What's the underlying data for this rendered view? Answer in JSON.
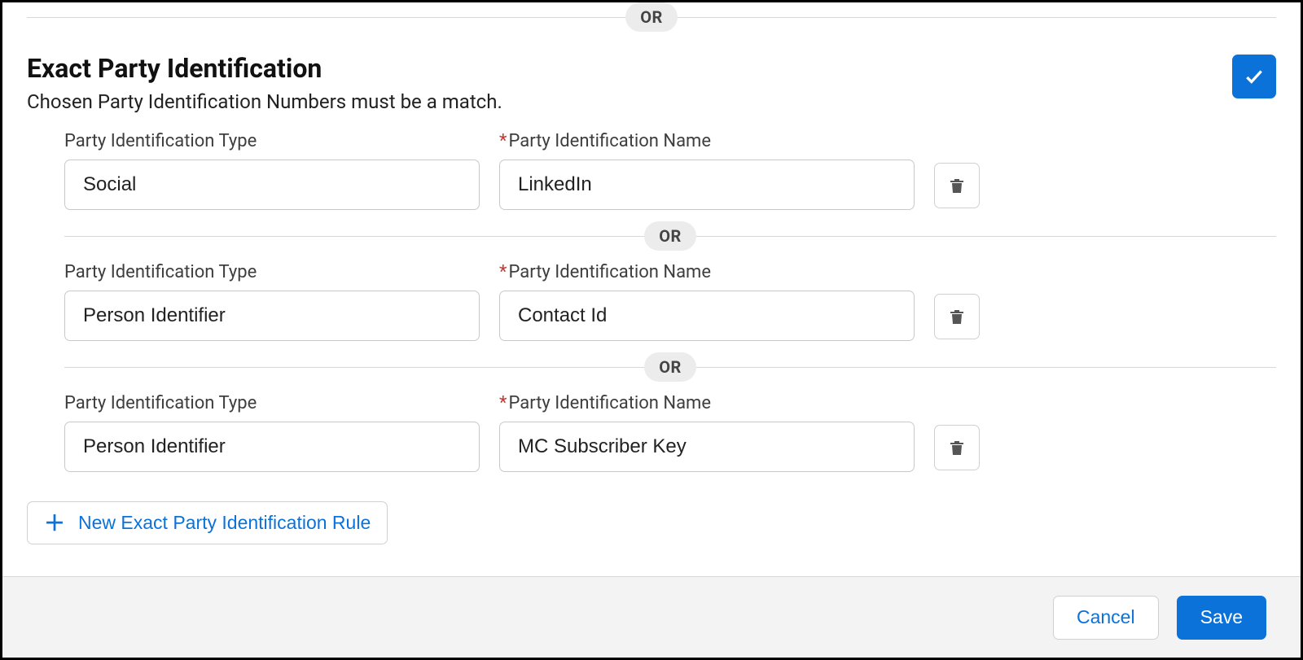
{
  "divider": {
    "or": "OR"
  },
  "section": {
    "title": "Exact Party Identification",
    "subtitle": "Chosen Party Identification Numbers must be a match."
  },
  "labels": {
    "party_type": "Party Identification Type",
    "party_name": "Party Identification Name",
    "required_mark": "*"
  },
  "rules": [
    {
      "type": "Social",
      "name": "LinkedIn"
    },
    {
      "type": "Person Identifier",
      "name": "Contact Id"
    },
    {
      "type": "Person Identifier",
      "name": "MC Subscriber Key"
    }
  ],
  "add_rule": {
    "label": "New Exact Party Identification Rule"
  },
  "footer": {
    "cancel": "Cancel",
    "save": "Save"
  }
}
